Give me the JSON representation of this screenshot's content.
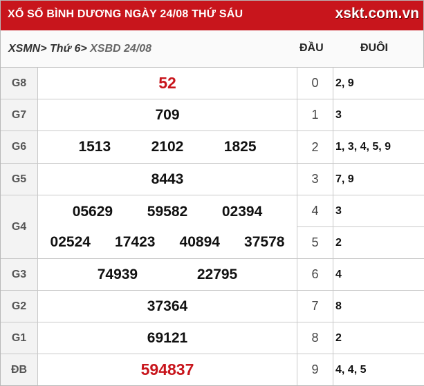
{
  "header": {
    "title": "XỔ SỐ BÌNH DƯƠNG NGÀY 24/08 THỨ SÁU",
    "logo": "xskt.com.vn"
  },
  "breadcrumb": {
    "item1": "XSMN",
    "sep1": ">",
    "item2": " Thứ 6",
    "sep2": ">",
    "item3": " XSBD 24/08"
  },
  "columns": {
    "dau": "ĐẦU",
    "duoi": "ĐUÔI"
  },
  "prizes": {
    "g8": {
      "label": "G8",
      "numbers": [
        "52"
      ]
    },
    "g7": {
      "label": "G7",
      "numbers": [
        "709"
      ]
    },
    "g6": {
      "label": "G6",
      "numbers": [
        "1513",
        "2102",
        "1825"
      ]
    },
    "g5": {
      "label": "G5",
      "numbers": [
        "8443"
      ]
    },
    "g4": {
      "label": "G4",
      "numbers": [
        "05629",
        "59582",
        "02394",
        "02524",
        "17423",
        "40894",
        "37578"
      ]
    },
    "g3": {
      "label": "G3",
      "numbers": [
        "74939",
        "22795"
      ]
    },
    "g2": {
      "label": "G2",
      "numbers": [
        "37364"
      ]
    },
    "g1": {
      "label": "G1",
      "numbers": [
        "69121"
      ]
    },
    "db": {
      "label": "ĐB",
      "numbers": [
        "594837"
      ]
    }
  },
  "loto": [
    {
      "dau": "0",
      "duoi": "2, 9"
    },
    {
      "dau": "1",
      "duoi": "3"
    },
    {
      "dau": "2",
      "duoi": "1, 3, 4, 5, 9"
    },
    {
      "dau": "3",
      "duoi": "7, 9"
    },
    {
      "dau": "4",
      "duoi": "3"
    },
    {
      "dau": "5",
      "duoi": "2"
    },
    {
      "dau": "6",
      "duoi": "4"
    },
    {
      "dau": "7",
      "duoi": "8"
    },
    {
      "dau": "8",
      "duoi": "2"
    },
    {
      "dau": "9",
      "duoi": "4, 4, 5"
    }
  ],
  "colors": {
    "brand_red": "#c8151c",
    "special_number": "#c8151c"
  }
}
